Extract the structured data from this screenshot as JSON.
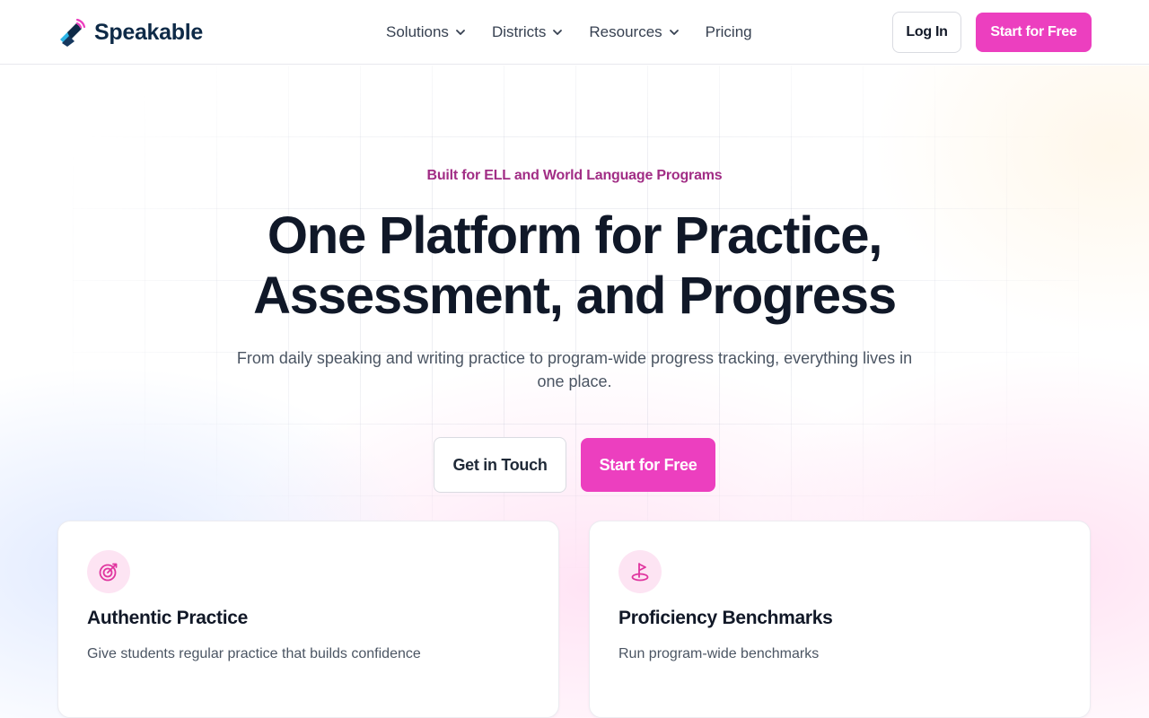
{
  "brand": {
    "name": "Speakable"
  },
  "nav": {
    "items": [
      {
        "label": "Solutions",
        "has_dropdown": true
      },
      {
        "label": "Districts",
        "has_dropdown": true
      },
      {
        "label": "Resources",
        "has_dropdown": true
      },
      {
        "label": "Pricing",
        "has_dropdown": false
      }
    ],
    "login_label": "Log In",
    "start_label": "Start for Free"
  },
  "hero": {
    "eyebrow": "Built for ELL and World Language Programs",
    "headline_line1": "One Platform for Practice,",
    "headline_line2": "Assessment, and Progress",
    "subtext": "From daily speaking and writing practice to program-wide progress tracking, everything lives in one place.",
    "secondary_cta": "Get in Touch",
    "primary_cta": "Start for Free"
  },
  "cards": [
    {
      "icon": "target-icon",
      "title": "Authentic Practice",
      "description": "Give students regular practice that builds confidence"
    },
    {
      "icon": "benchmark-flag-icon",
      "title": "Proficiency Benchmarks",
      "description": "Run program-wide benchmarks"
    }
  ],
  "colors": {
    "accent": "#ec3fbf",
    "eyebrow": "#a12d85",
    "brand_navy": "#0e2a47",
    "icon_bg": "#fde4f3"
  }
}
